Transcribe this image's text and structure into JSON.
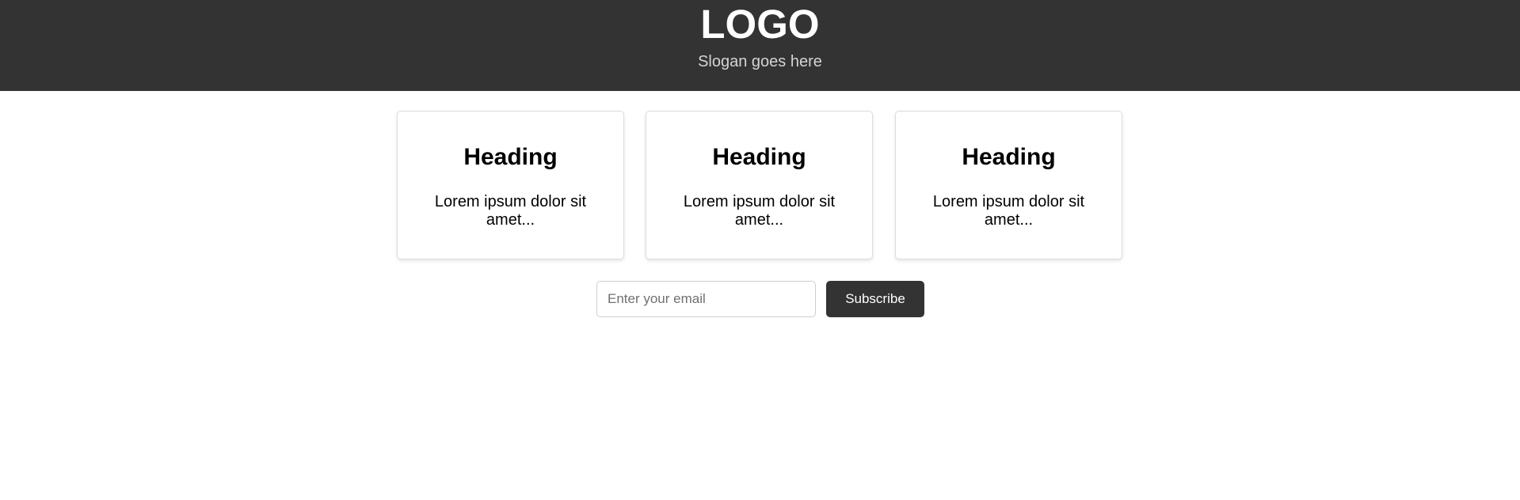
{
  "header": {
    "logo": "LOGO",
    "slogan": "Slogan goes here"
  },
  "cards": [
    {
      "heading": "Heading",
      "text": "Lorem ipsum dolor sit amet..."
    },
    {
      "heading": "Heading",
      "text": "Lorem ipsum dolor sit amet..."
    },
    {
      "heading": "Heading",
      "text": "Lorem ipsum dolor sit amet..."
    }
  ],
  "subscribe": {
    "email_placeholder": "Enter your email",
    "email_value": "",
    "button_label": "Subscribe"
  },
  "colors": {
    "header_background": "#333333",
    "button_background": "#333333",
    "logo_text": "#ffffff",
    "slogan_text": "#d4d4d4"
  }
}
